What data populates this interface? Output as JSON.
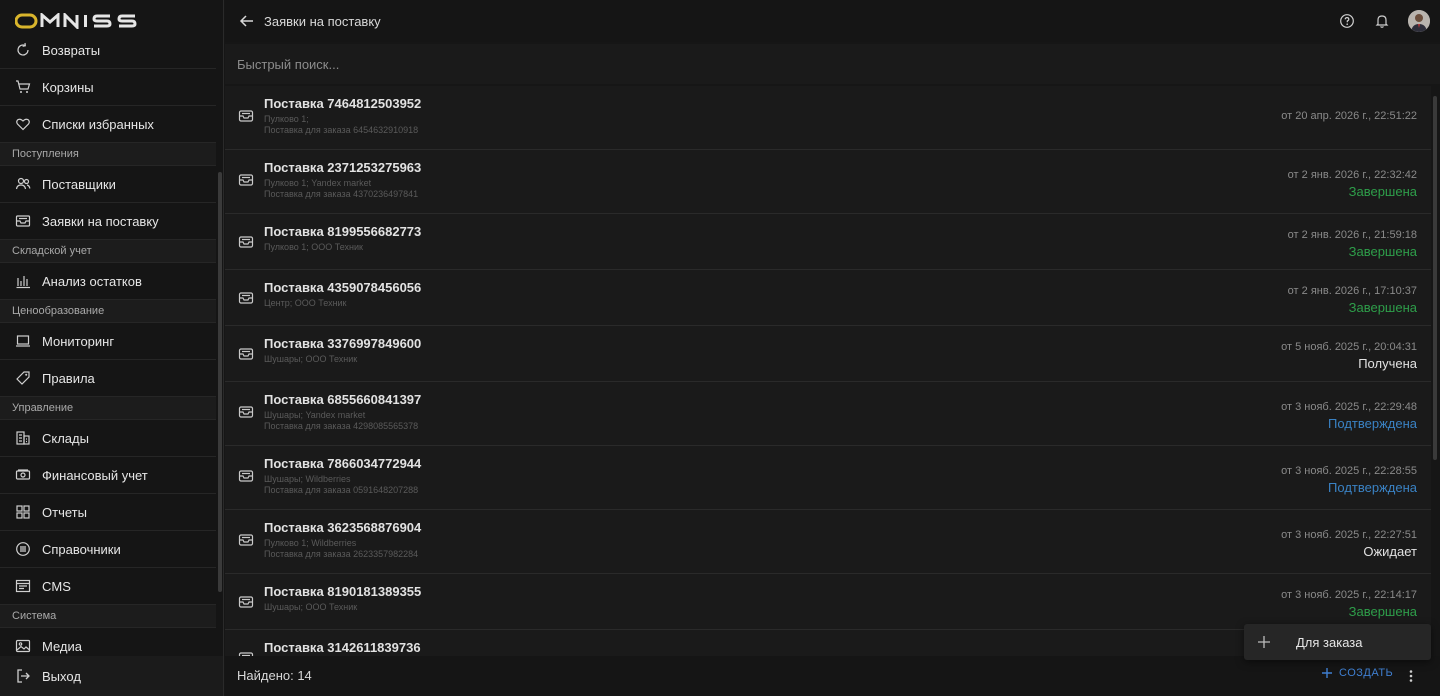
{
  "brand": "OMNIS",
  "header": {
    "title": "Заявки на поставку"
  },
  "search": {
    "placeholder": "Быстрый поиск..."
  },
  "sidebar": {
    "items": [
      {
        "type": "item",
        "label": "Возвраты",
        "icon": "refresh-icon"
      },
      {
        "type": "item",
        "label": "Корзины",
        "icon": "cart-icon"
      },
      {
        "type": "item",
        "label": "Списки избранных",
        "icon": "heart-icon"
      },
      {
        "type": "section",
        "label": "Поступления"
      },
      {
        "type": "item",
        "label": "Поставщики",
        "icon": "users-icon"
      },
      {
        "type": "item",
        "label": "Заявки на поставку",
        "icon": "inbox-icon"
      },
      {
        "type": "section",
        "label": "Складской учет"
      },
      {
        "type": "item",
        "label": "Анализ остатков",
        "icon": "bar-chart-icon"
      },
      {
        "type": "section",
        "label": "Ценообразование"
      },
      {
        "type": "item",
        "label": "Мониторинг",
        "icon": "laptop-icon"
      },
      {
        "type": "item",
        "label": "Правила",
        "icon": "tag-icon"
      },
      {
        "type": "section",
        "label": "Управление"
      },
      {
        "type": "item",
        "label": "Склады",
        "icon": "building-icon"
      },
      {
        "type": "item",
        "label": "Финансовый учет",
        "icon": "money-icon"
      },
      {
        "type": "item",
        "label": "Отчеты",
        "icon": "grid-icon"
      },
      {
        "type": "item",
        "label": "Справочники",
        "icon": "list-circle-icon"
      },
      {
        "type": "item",
        "label": "CMS",
        "icon": "cms-icon"
      },
      {
        "type": "section",
        "label": "Система"
      },
      {
        "type": "item",
        "label": "Медиа",
        "icon": "image-icon"
      }
    ],
    "logout": "Выход"
  },
  "rows": [
    {
      "title": "Поставка 7464812503952",
      "lines": [
        "Пулково 1;",
        "Поставка для заказа 6454632910918"
      ],
      "date": "от 20 апр. 2026 г., 22:51:22",
      "status": ""
    },
    {
      "title": "Поставка 2371253275963",
      "lines": [
        "Пулково 1; Yandex market",
        "Поставка для заказа 4370236497841"
      ],
      "date": "от 2 янв. 2026 г., 22:32:42",
      "status": "Завершена",
      "status_kind": "done"
    },
    {
      "title": "Поставка 8199556682773",
      "lines": [
        "Пулково 1; ООО Техник"
      ],
      "date": "от 2 янв. 2026 г., 21:59:18",
      "status": "Завершена",
      "status_kind": "done"
    },
    {
      "title": "Поставка 4359078456056",
      "lines": [
        "Центр; ООО Техник"
      ],
      "date": "от 2 янв. 2026 г., 17:10:37",
      "status": "Завершена",
      "status_kind": "done"
    },
    {
      "title": "Поставка 3376997849600",
      "lines": [
        "Шушары; ООО Техник"
      ],
      "date": "от 5 нояб. 2025 г., 20:04:31",
      "status": "Получена",
      "status_kind": "recv"
    },
    {
      "title": "Поставка 6855660841397",
      "lines": [
        "Шушары; Yandex market",
        "Поставка для заказа 4298085565378"
      ],
      "date": "от 3 нояб. 2025 г., 22:29:48",
      "status": "Подтверждена",
      "status_kind": "conf"
    },
    {
      "title": "Поставка 7866034772944",
      "lines": [
        "Шушары; Wildberries",
        "Поставка для заказа 0591648207288"
      ],
      "date": "от 3 нояб. 2025 г., 22:28:55",
      "status": "Подтверждена",
      "status_kind": "conf"
    },
    {
      "title": "Поставка 3623568876904",
      "lines": [
        "Пулково 1; Wildberries",
        "Поставка для заказа 2623357982284"
      ],
      "date": "от 3 нояб. 2025 г., 22:27:51",
      "status": "Ожидает",
      "status_kind": "wait"
    },
    {
      "title": "Поставка 8190181389355",
      "lines": [
        "Шушары; ООО Техник"
      ],
      "date": "от 3 нояб. 2025 г., 22:14:17",
      "status": "Завершена",
      "status_kind": "done"
    },
    {
      "title": "Поставка 3142611839736",
      "lines": [],
      "date": "",
      "status": ""
    }
  ],
  "footer": {
    "found": "Найдено: 14",
    "create": "СОЗДАТЬ"
  },
  "popup": {
    "item": "Для заказа"
  },
  "colors": {
    "done": "#2e9e4a",
    "confirmed": "#3a82c4",
    "accent": "#3f7fd1",
    "logo": "#d9b52c"
  }
}
